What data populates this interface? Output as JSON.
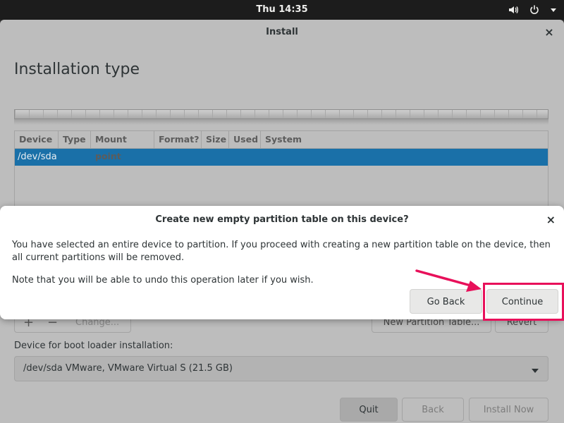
{
  "topbar": {
    "clock": "Thu 14:35",
    "icons": [
      "volume-icon",
      "power-icon",
      "chevron-down-icon"
    ]
  },
  "window": {
    "title": "Install",
    "close_glyph": "×",
    "page_title": "Installation type",
    "table": {
      "columns": [
        "Device",
        "Type",
        "Mount point",
        "Format?",
        "Size",
        "Used",
        "System"
      ],
      "rows": [
        "/dev/sda"
      ]
    },
    "toolbar": {
      "add_glyph": "+",
      "remove_glyph": "−",
      "change_label": "Change...",
      "new_partition_table_label": "New Partition Table...",
      "revert_label": "Revert"
    },
    "boot_loader": {
      "label": "Device for boot loader installation:",
      "selected": "/dev/sda VMware, VMware Virtual S (21.5 GB)"
    },
    "buttons": {
      "quit": "Quit",
      "back": "Back",
      "install_now": "Install Now"
    }
  },
  "dialog": {
    "title": "Create new empty partition table on this device?",
    "close_glyph": "×",
    "message": "You have selected an entire device to partition. If you proceed with creating a new partition table on the device, then all current partitions will be removed.",
    "note": "Note that you will be able to undo this operation later if you wish.",
    "go_back_label": "Go Back",
    "continue_label": "Continue"
  },
  "colors": {
    "selection": "#1a70a8",
    "highlight": "#e8105a",
    "topbar": "#1c1c1c"
  }
}
